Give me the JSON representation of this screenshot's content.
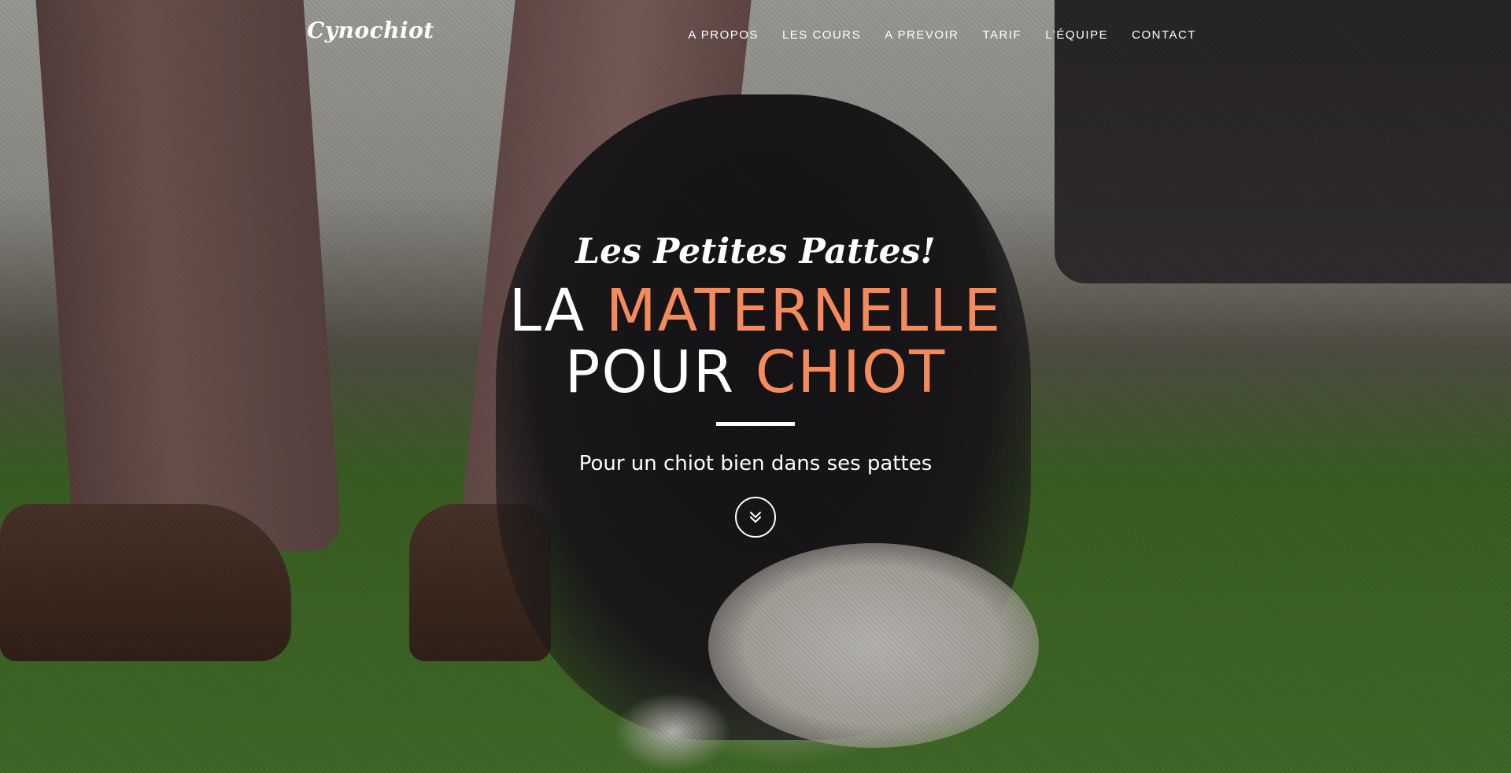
{
  "brand": {
    "name": "Cynochiot"
  },
  "nav": {
    "items": [
      {
        "label": "A PROPOS"
      },
      {
        "label": "LES COURS"
      },
      {
        "label": "A PREVOIR"
      },
      {
        "label": "TARIF"
      },
      {
        "label": "L'ÉQUIPE"
      },
      {
        "label": "CONTACT"
      }
    ]
  },
  "hero": {
    "script_heading": "Les Petites Pattes!",
    "title_line1_plain": "LA",
    "title_line1_accent": "MATERNELLE",
    "title_line2_plain": "POUR",
    "title_line2_accent": "CHIOT",
    "subtitle": "Pour un chiot bien dans ses pattes",
    "scroll_icon": "double-chevron-down-icon"
  },
  "colors": {
    "accent": "#f58a5c",
    "text": "#ffffff"
  }
}
